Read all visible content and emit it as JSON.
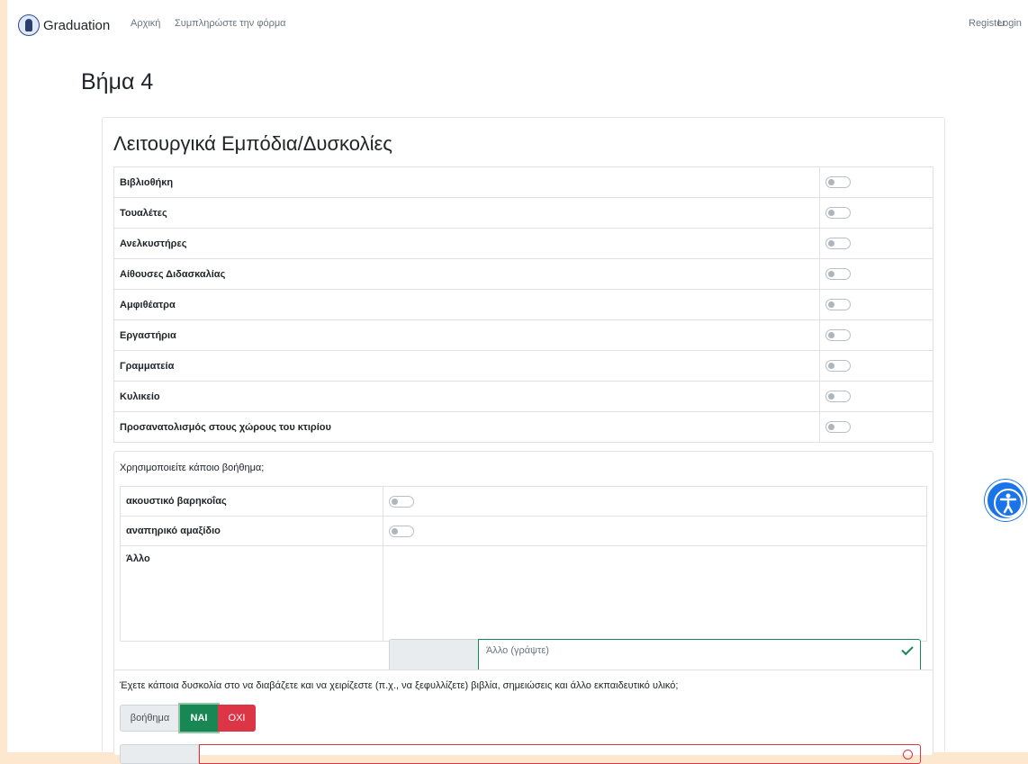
{
  "navbar": {
    "brand": "Graduation",
    "links": [
      "Αρχική",
      "Συμπληρώστε την φόρμα"
    ],
    "register": "Register",
    "login": "Login"
  },
  "page_title": "Βήμα 4",
  "section": {
    "title": "Λειτουργικά Εμπόδια/Δυσκολίες",
    "items": [
      {
        "label": "Βιβλιοθήκη",
        "checked": false
      },
      {
        "label": "Τουαλέτες",
        "checked": false
      },
      {
        "label": "Ανελκυστήρες",
        "checked": false
      },
      {
        "label": "Αίθουσες Διδασκαλίας",
        "checked": false
      },
      {
        "label": "Αμφιθέατρα",
        "checked": false
      },
      {
        "label": "Εργαστήρια",
        "checked": false
      },
      {
        "label": "Γραμματεία",
        "checked": false
      },
      {
        "label": "Κυλικείο",
        "checked": false
      },
      {
        "label": "Προσανατολισμός στους χώρους του κτιρίου",
        "checked": false
      }
    ]
  },
  "aids": {
    "question": "Χρησιμοποιείτε κάποιο βοήθημα;",
    "items": [
      {
        "label": "ακουστικό βαρηκοΐας",
        "checked": false
      },
      {
        "label": "αναπηρικό αμαξίδιο",
        "checked": false
      }
    ],
    "other_label": "Άλλο",
    "other_addon": "Άλλο (γράψτε)",
    "other_placeholder": "Άλλο (γράψτε)"
  },
  "reading": {
    "question": "Έχετε κάποια δυσκολία στο να διαβάζετε και να χειρίζεστε (π.χ., να ξεφυλλίζετε) βιβλία, σημειώσεις και άλλο εκπαιδευτικό υλικό;",
    "toggle_label": "βοήθημα",
    "yes": "ΝΑΙ",
    "no": "ΟΧΙ"
  },
  "colors": {
    "accent_green": "#198754",
    "accent_red": "#dc3545",
    "accessibility_blue": "#1a73e8"
  }
}
